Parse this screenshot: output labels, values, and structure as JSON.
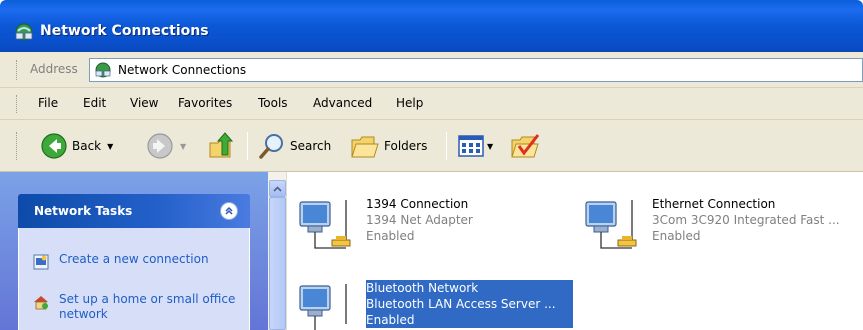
{
  "window": {
    "title": "Network Connections"
  },
  "address": {
    "label": "Address",
    "value": "Network Connections"
  },
  "menu": [
    "File",
    "Edit",
    "View",
    "Favorites",
    "Tools",
    "Advanced",
    "Help"
  ],
  "toolbar": {
    "back_label": "Back",
    "search_label": "Search",
    "folders_label": "Folders"
  },
  "taskpane": {
    "header": "Network Tasks",
    "tasks": [
      {
        "label": "Create a new connection",
        "icon": "new-connection-icon"
      },
      {
        "label": "Set up a home or small office network",
        "icon": "home-network-icon"
      }
    ]
  },
  "connections": [
    {
      "name": "1394 Connection",
      "device": "1394 Net Adapter",
      "status": "Enabled",
      "selected": false
    },
    {
      "name": "Ethernet Connection",
      "device": "3Com 3C920 Integrated Fast ...",
      "status": "Enabled",
      "selected": false
    },
    {
      "name": "Bluetooth Network",
      "device": "Bluetooth LAN Access Server ...",
      "status": "Enabled",
      "selected": true
    }
  ],
  "colors": {
    "title_blue": "#0a5fd8",
    "selection": "#316ac5",
    "task_link": "#215dc6",
    "chrome": "#ece9d8"
  }
}
